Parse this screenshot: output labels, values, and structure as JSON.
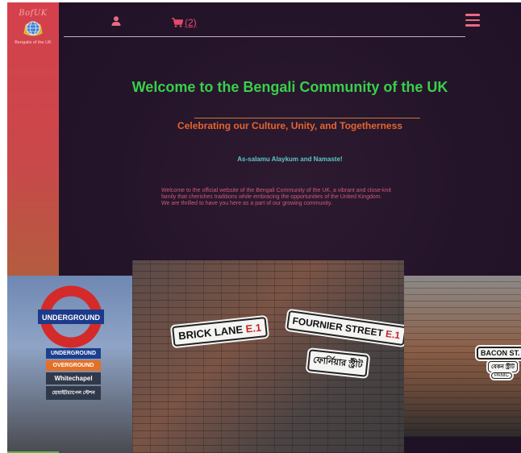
{
  "brand": {
    "logo_text": "BofUK",
    "logo_subtitle": "Bengalis of the UK"
  },
  "topbar": {
    "user_icon": "user-icon",
    "cart_icon": "cart-icon",
    "cart_label": "(2)",
    "menu_icon": "hamburger-menu-icon"
  },
  "hero": {
    "title": "Welcome to the Bengali Community of the UK",
    "subtitle": "Celebrating our Culture, Unity, and Togetherness",
    "greeting": "As-salamu Alaykum and Namaste!",
    "intro_lines": [
      "Welcome to the official website of the Bengali Community of the UK, a vibrant and close-knit",
      "family that cherishes traditions while embracing the opportunities of the United Kingdom.",
      "We are thrilled to have you here as a part of our growing community."
    ]
  },
  "photos": {
    "left": {
      "roundel_text": "UNDERGROUND",
      "box_underground": "UNDERGROUND",
      "box_overground": "OVERGROUND",
      "box_station": "Whitechapel",
      "box_station_bn": "হোয়াইটচ্যাপেল স্টেশন"
    },
    "center": {
      "sign_brick_lane": "BRICK LANE",
      "sign_brick_lane_code": "E.1",
      "sign_fournier": "FOURNIER STREET",
      "sign_fournier_code": "E.1",
      "sign_bengali": "ফোর্নিয়ার স্ট্রীট"
    },
    "right": {
      "sign_bacon": "BACON ST.",
      "sign_bacon_bn": "বেকন স্ট্রীট",
      "sign_panic": "PANIC"
    }
  },
  "colors": {
    "background": "#24142a",
    "sidebar_top": "#d5404c",
    "sidebar_bottom": "#5aa84a",
    "title_green": "#38d04a",
    "subtitle_orange": "#e5652f",
    "greeting_teal": "#5bc7c9",
    "intro_pink": "#d05a78",
    "icon_pink": "#e96a82"
  }
}
